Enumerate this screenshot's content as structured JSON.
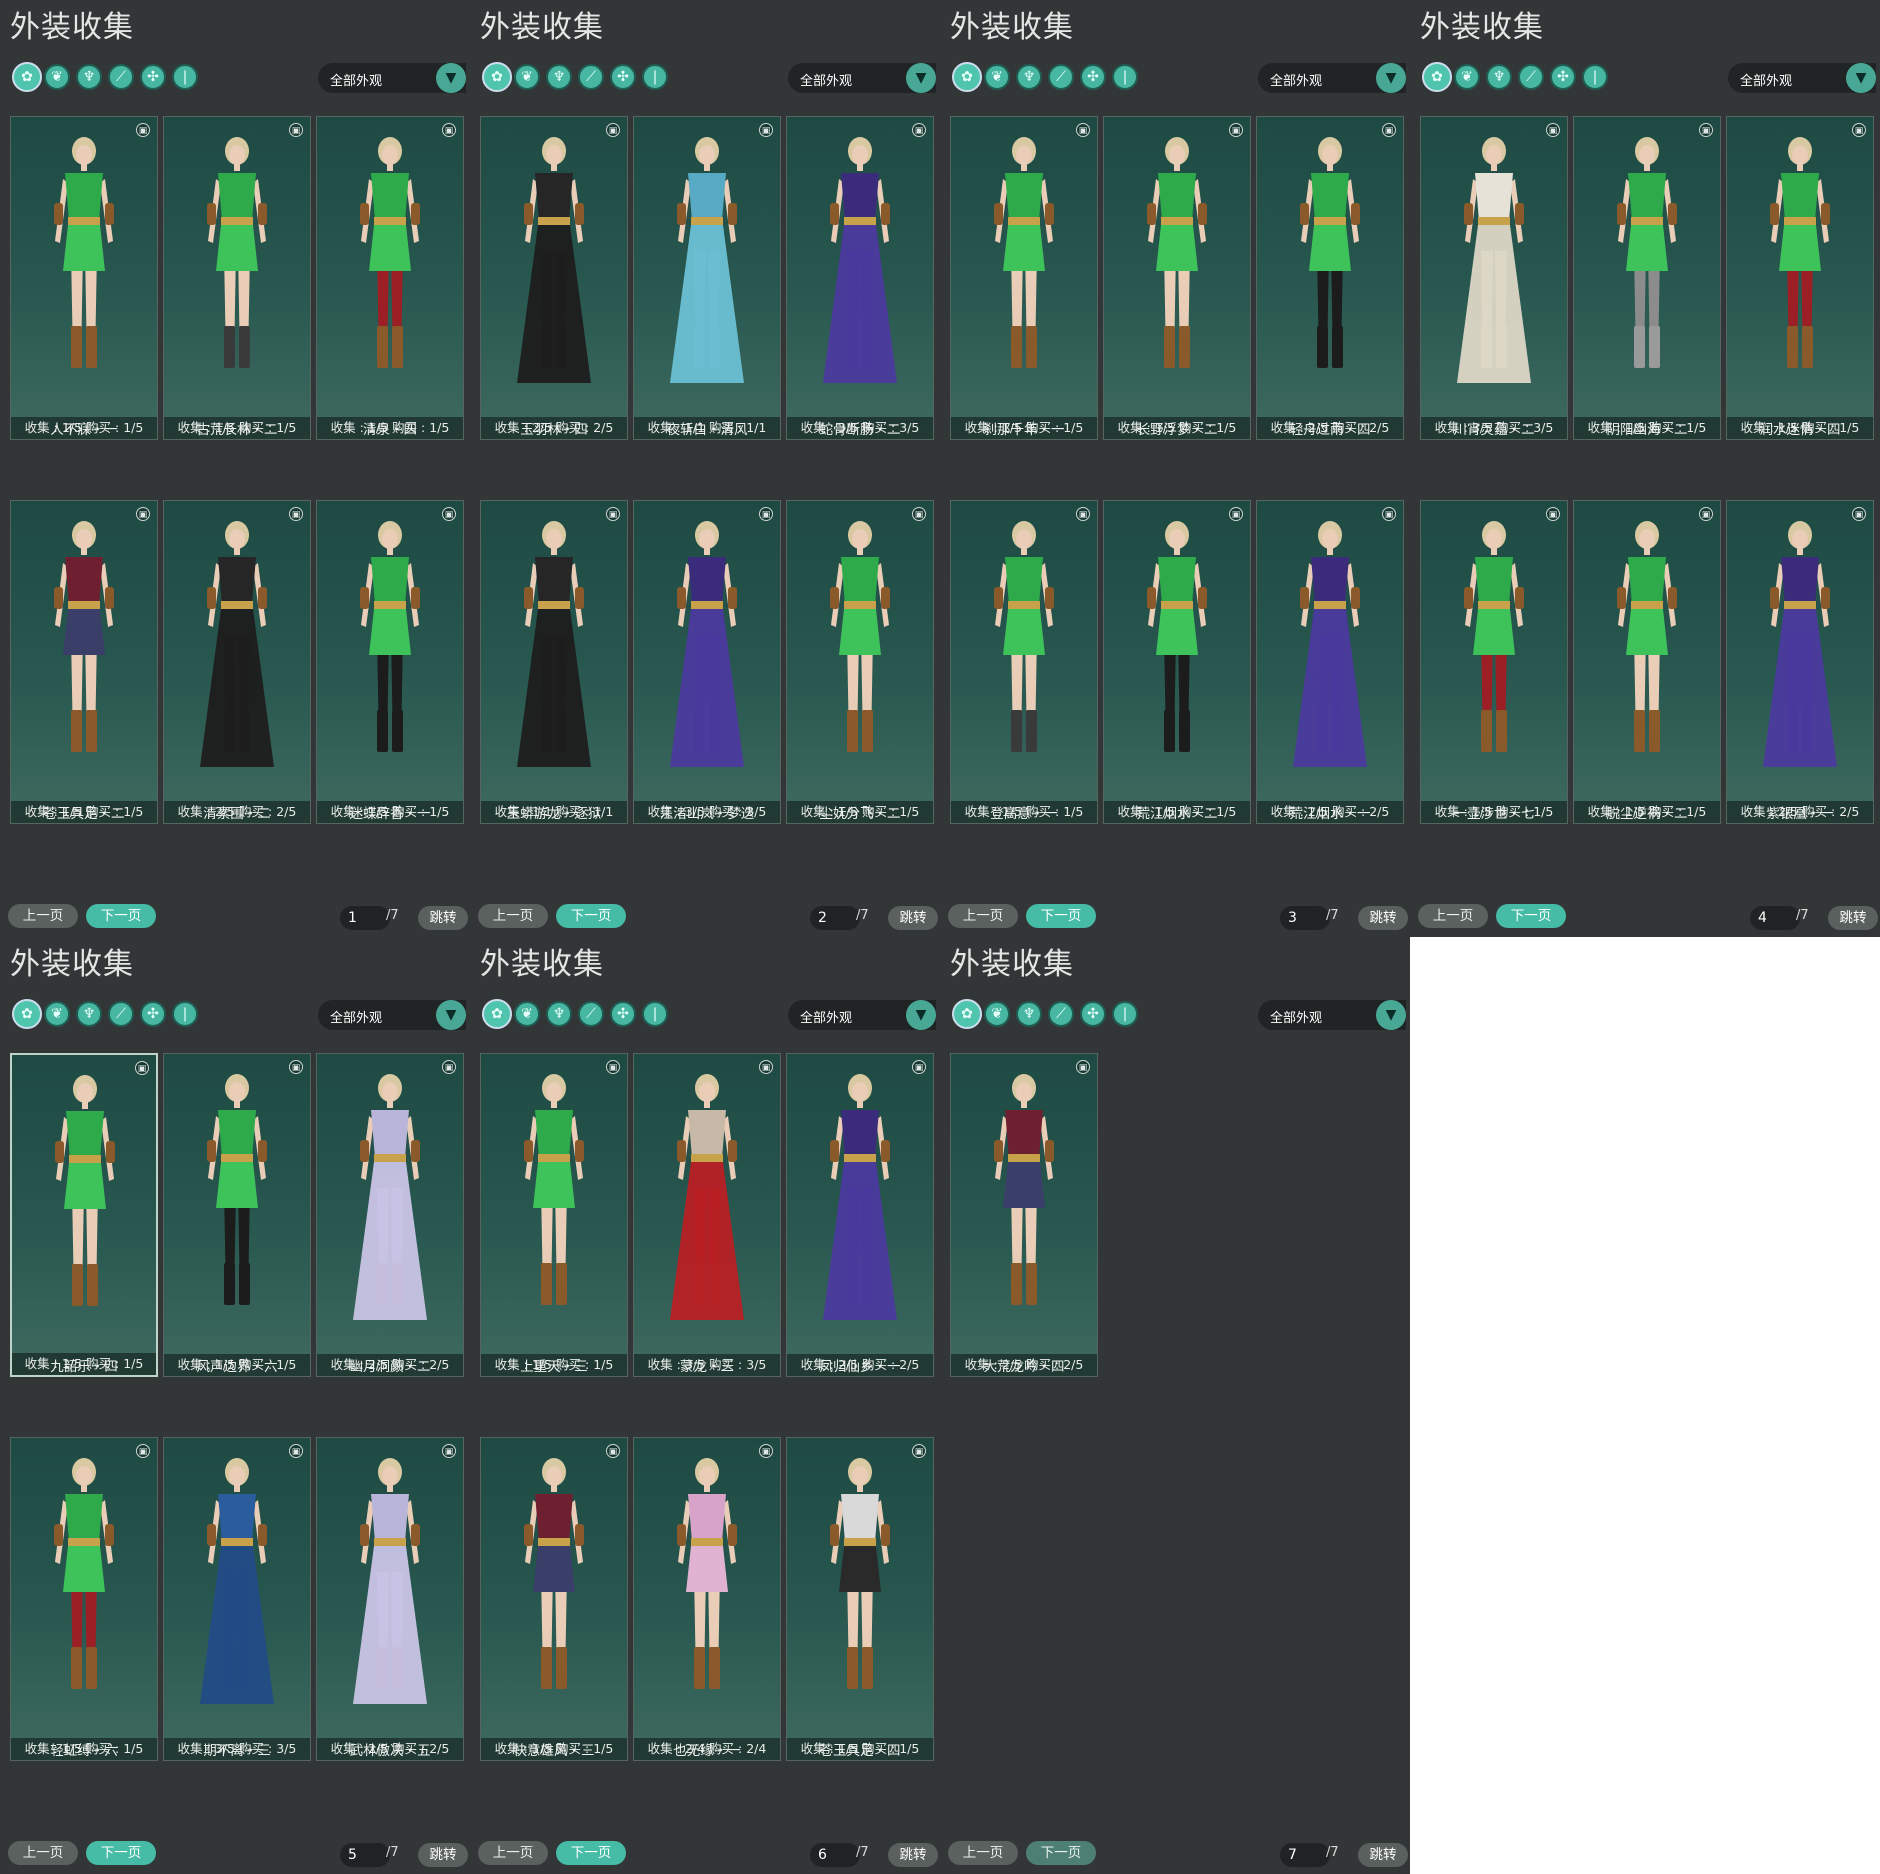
{
  "panel_title": "外装收集",
  "filter_label": "全部外观",
  "tab_icons": [
    "outfit-icon",
    "top-icon",
    "dress-icon",
    "shoe-icon",
    "accessory-icon",
    "boot-icon"
  ],
  "pager": {
    "prev": "上一页",
    "next": "下一页",
    "total": "/7",
    "jump": "跳转"
  },
  "stat_labels": {
    "collect": "收集",
    "buy": "购买"
  },
  "pages": [
    {
      "page": "1",
      "cards": [
        {
          "name": "人不寐・一",
          "collect": "1/5",
          "buy": "1/5",
          "outfit": "green"
        },
        {
          "name": "古荒长林・二",
          "collect": "1/5",
          "buy": "1/5",
          "outfit": "green-boots"
        },
        {
          "name": "清泉・四",
          "collect": "1/5",
          "buy": "1/5",
          "outfit": "green-red"
        },
        {
          "name": "苍玉具足・二",
          "collect": "1/5",
          "buy": "1/5",
          "outfit": "red-short"
        },
        {
          "name": "清素围・二",
          "collect": "2/5",
          "buy": "2/5",
          "outfit": "black-long"
        },
        {
          "name": "迷蝶辞香・一",
          "collect": "1/5",
          "buy": "1/5",
          "outfit": "green-black"
        }
      ]
    },
    {
      "page": "2",
      "cards": [
        {
          "name": "玉羽林・四",
          "collect": "2/5",
          "buy": "2/5",
          "outfit": "black-long"
        },
        {
          "name": "夜斩白・清风",
          "collect": "1/1",
          "buy": "1/1",
          "outfit": "cyan-long"
        },
        {
          "name": "蛇骨断肠・二",
          "collect": "3/5",
          "buy": "3/5",
          "outfit": "purple-long"
        },
        {
          "name": "玉蟒游龙・逐狱",
          "collect": "1/1",
          "buy": "1/1",
          "outfit": "black-long"
        },
        {
          "name": "江渚山岚・梦迭",
          "collect": "3/5",
          "buy": "3/5",
          "outfit": "purple-long"
        },
        {
          "name": "尘妩分飞・二",
          "collect": "1/5",
          "buy": "1/5",
          "outfit": "green"
        }
      ]
    },
    {
      "page": "3",
      "cards": [
        {
          "name": "刹那千年・一",
          "collect": "1/5",
          "buy": "1/5",
          "outfit": "green"
        },
        {
          "name": "长野浮梦・二",
          "collect": "1/5",
          "buy": "1/5",
          "outfit": "green"
        },
        {
          "name": "轻舟过雨・四",
          "collect": "2/5",
          "buy": "2/5",
          "outfit": "green-black"
        },
        {
          "name": "登高意・一",
          "collect": "1/5",
          "buy": "1/5",
          "outfit": "green-boots"
        },
        {
          "name": "荒江烟水・二",
          "collect": "1/5",
          "buy": "1/5",
          "outfit": "green-black"
        },
        {
          "name": "荒江烟水・一",
          "collect": "2/5",
          "buy": "2/5",
          "outfit": "purple-long"
        }
      ]
    },
    {
      "page": "4",
      "cards": [
        {
          "name": "川宵灵蕴・二",
          "collect": "3/5",
          "buy": "3/5",
          "outfit": "white-long"
        },
        {
          "name": "阴阳幽海・二",
          "collect": "1/5",
          "buy": "1/5",
          "outfit": "green-grey"
        },
        {
          "name": "润水迷情・四",
          "collect": "1/5",
          "buy": "1/5",
          "outfit": "green-red"
        },
        {
          "name": "一壶涉世・七",
          "collect": "1/5",
          "buy": "1/5",
          "outfit": "green-red"
        },
        {
          "name": "脱尘逆祸・二",
          "collect": "1/5",
          "buy": "1/5",
          "outfit": "green"
        },
        {
          "name": "紫银凰・一",
          "collect": "2/5",
          "buy": "2/5",
          "outfit": "purple-long"
        }
      ]
    },
    {
      "page": "5",
      "cards": [
        {
          "name": "九韶乐・四",
          "collect": "1/5",
          "buy": "1/5",
          "outfit": "green",
          "selected": true
        },
        {
          "name": "风声边界・六",
          "collect": "1/5",
          "buy": "1/5",
          "outfit": "green-black"
        },
        {
          "name": "幽月洞颜・二",
          "collect": "2/5",
          "buy": "2/5",
          "outfit": "lavender-long"
        },
        {
          "name": "轻虹缚・六",
          "collect": "1/5",
          "buy": "1/5",
          "outfit": "green-red"
        },
        {
          "name": "期不离・三",
          "collect": "3/5",
          "buy": "3/5",
          "outfit": "blue-long"
        },
        {
          "name": "武林傲决・五",
          "collect": "2/5",
          "buy": "2/5",
          "outfit": "lavender-long"
        }
      ]
    },
    {
      "page": "6",
      "cards": [
        {
          "name": "上重天・三",
          "collect": "1/5",
          "buy": "1/5",
          "outfit": "green"
        },
        {
          "name": "蒙龙・三",
          "collect": "3/5",
          "buy": "3/5",
          "outfit": "red-long"
        },
        {
          "name": "凤归仙乡・一",
          "collect": "2/5",
          "buy": "2/5",
          "outfit": "purple-long"
        },
        {
          "name": "快意雄风・三",
          "collect": "1/5",
          "buy": "1/5",
          "outfit": "red-short"
        },
        {
          "name": "也无缘・一",
          "collect": "2/4",
          "buy": "2/4",
          "outfit": "pink-short"
        },
        {
          "name": "苍玉具足・四",
          "collect": "1/5",
          "buy": "1/5",
          "outfit": "stripe-short"
        }
      ]
    },
    {
      "page": "7",
      "cards": [
        {
          "name": "大荒龙吟・四",
          "collect": "2/5",
          "buy": "2/5",
          "outfit": "red-short"
        }
      ]
    }
  ],
  "colors": {
    "panel_bg": "#323637",
    "card_top": "#1e4a43",
    "card_bottom": "#3f6a5f",
    "accent": "#46bba5",
    "skin": "#e9cdb7",
    "hair_blonde": "#d9c9a2"
  }
}
